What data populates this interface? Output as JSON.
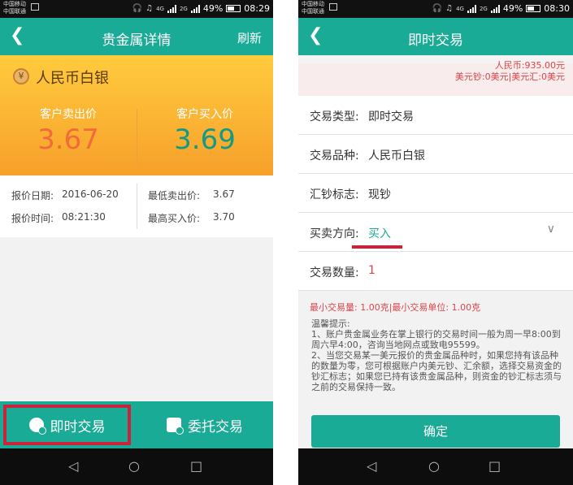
{
  "left": {
    "status": {
      "carrier1": "中国移动",
      "carrier2": "中国联通",
      "net1": "4G",
      "net2": "2G",
      "battery": "49%",
      "time": "08:29",
      "battery_level": 0.49
    },
    "header": {
      "title": "贵金属详情",
      "refresh_label": "刷新"
    },
    "metal": {
      "icon_glyph": "¥",
      "name": "人民币白银"
    },
    "prices": {
      "sell_label": "客户卖出价",
      "sell_value": "3.67",
      "buy_label": "客户买入价",
      "buy_value": "3.69"
    },
    "info": {
      "date_label": "报价日期:",
      "date_value": "2016-06-20",
      "time_label": "报价时间:",
      "time_value": "08:21:30",
      "min_sell_label": "最低卖出价:",
      "min_sell_value": "3.67",
      "max_buy_label": "最高买入价:",
      "max_buy_value": "3.70"
    },
    "tabs": {
      "instant": "即时交易",
      "entrust": "委托交易"
    }
  },
  "right": {
    "status": {
      "carrier1": "中国移动",
      "carrier2": "中国联通",
      "net1": "4G",
      "net2": "2G",
      "battery": "49%",
      "time": "08:30",
      "battery_level": 0.49
    },
    "header": {
      "title": "即时交易"
    },
    "balance": {
      "line1": "人民币:935.00元",
      "line2": "美元钞:0美元|美元汇:0美元"
    },
    "form": {
      "type_label": "交易类型:",
      "type_value": "即时交易",
      "variety_label": "交易品种:",
      "variety_value": "人民币白银",
      "cash_label": "汇钞标志:",
      "cash_value": "现钞",
      "direction_label": "买卖方向:",
      "direction_value": "买入",
      "qty_label": "交易数量:",
      "qty_value": "1"
    },
    "min_trade": "最小交易量: 1.00克|最小交易单位: 1.00克",
    "tips": {
      "title": "温馨提示:",
      "item1": "1、账户贵金属业务在掌上银行的交易时间一般为周一早8:00到周六早4:00，咨询当地网点或致电95599。",
      "item2": "2、当您交易某一美元报价的贵金属品种时，如果您持有该品种的数量为零，您可根据账户内美元钞、汇余额，选择交易资金的钞汇标志；如果您已持有该贵金属品种，则资金的钞汇标志须与之前的交易保持一致。"
    },
    "confirm_label": "确定"
  },
  "colors": {
    "accent": "#1aab97",
    "highlight": "#c9243b",
    "sell": "#f26b3a",
    "buy": "#149a84",
    "orange_top": "#ffcb3e",
    "orange_bottom": "#f7a02a"
  },
  "icons": {
    "back": "back-arrow-icon",
    "nav_back": "nav-back-icon",
    "nav_home": "nav-home-icon",
    "nav_recent": "nav-recent-icon"
  }
}
